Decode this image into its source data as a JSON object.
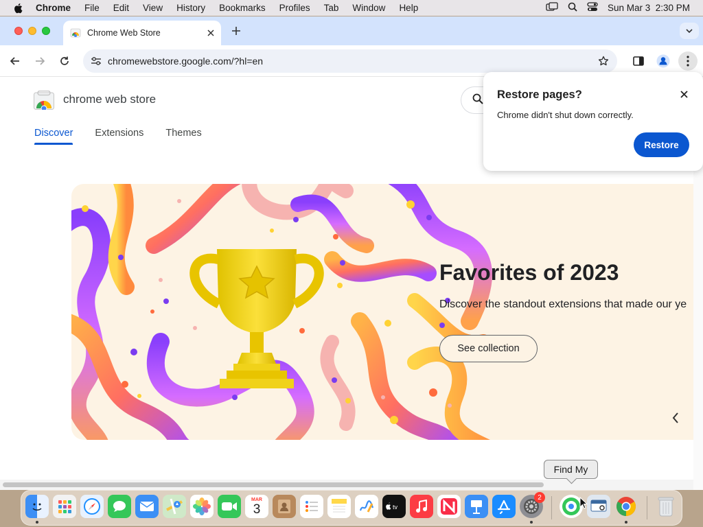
{
  "menubar": {
    "app_name": "Chrome",
    "items": [
      "File",
      "Edit",
      "View",
      "History",
      "Bookmarks",
      "Profiles",
      "Tab",
      "Window",
      "Help"
    ],
    "datetime": "Sun Mar 3  2:30 PM"
  },
  "browser": {
    "tab_title": "Chrome Web Store",
    "url": "chromewebstore.google.com/?hl=en"
  },
  "store": {
    "brand": "chrome web store",
    "nav": [
      "Discover",
      "Extensions",
      "Themes"
    ],
    "active_nav": "Discover"
  },
  "hero": {
    "title": "Favorites of 2023",
    "description": "Discover the standout extensions that made our ye",
    "button": "See collection"
  },
  "restore_popup": {
    "title": "Restore pages?",
    "message": "Chrome didn't shut down correctly.",
    "button": "Restore"
  },
  "dock": {
    "tooltip": "Find My",
    "calendar_month": "MAR",
    "calendar_day": "3",
    "settings_badge": "2",
    "apps": [
      "Finder",
      "Launchpad",
      "Safari",
      "Messages",
      "Mail",
      "Maps",
      "Photos",
      "FaceTime",
      "Calendar",
      "Contacts",
      "Reminders",
      "Notes",
      "Freeform",
      "TV",
      "Music",
      "News",
      "Keynote",
      "App Store",
      "System Settings",
      "Find My",
      "Preview",
      "Chrome",
      "Trash"
    ]
  },
  "colors": {
    "accent": "#0b57d0",
    "tabstrip": "#d3e3fd",
    "hero_bg": "#fdf3e4"
  }
}
